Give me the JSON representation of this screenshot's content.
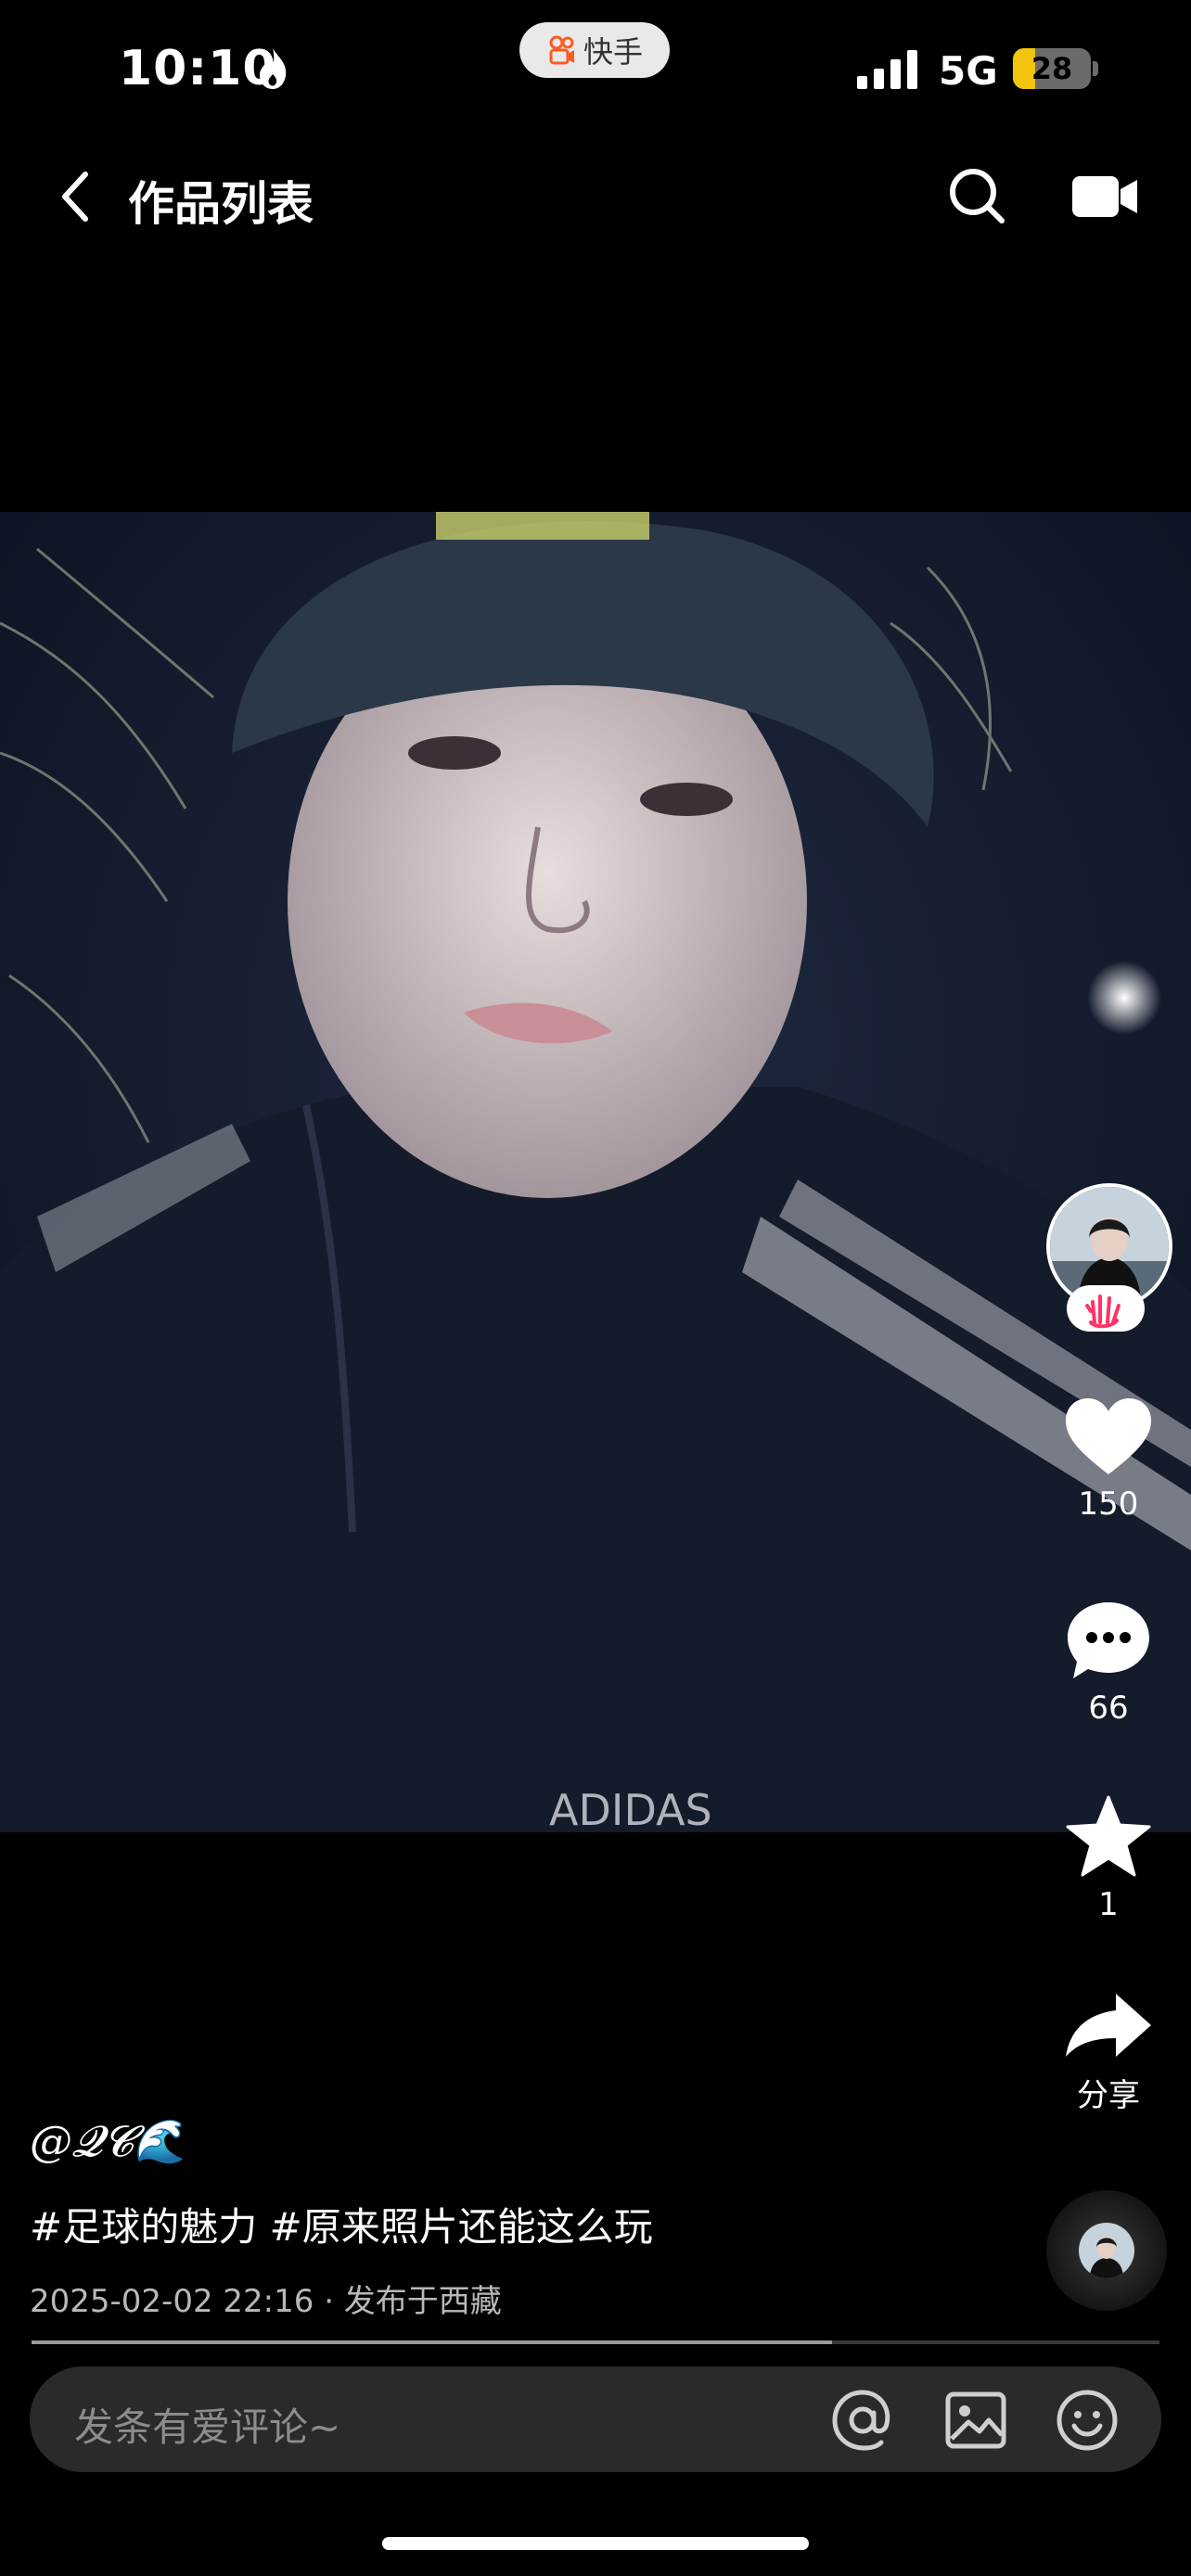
{
  "status_bar": {
    "time": "10:10",
    "app_pill": "快手",
    "network": "5G",
    "battery": "28",
    "battery_level": 0.28
  },
  "nav": {
    "title": "作品列表"
  },
  "rail": {
    "likes": "150",
    "comments": "66",
    "favorites": "1",
    "share_label": "分享"
  },
  "post": {
    "author": "@𝓠𝓒🌊",
    "tags": "#足球的魅力 #原来照片还能这么玩",
    "meta": "2025-02-02 22:16 · 发布于西藏"
  },
  "progress": {
    "value": 0.71
  },
  "comment_bar": {
    "placeholder": "发条有爱评论~"
  },
  "colors": {
    "background": "#000000",
    "battery": "#f2c40d",
    "follow_accent": "#ff3366"
  },
  "icons": [
    "flame-icon",
    "kuaishou-icon",
    "signal-icon",
    "back-icon",
    "search-icon",
    "camera-icon",
    "heart-icon",
    "comment-icon",
    "star-icon",
    "share-icon",
    "at-icon",
    "image-icon",
    "emoji-icon"
  ]
}
